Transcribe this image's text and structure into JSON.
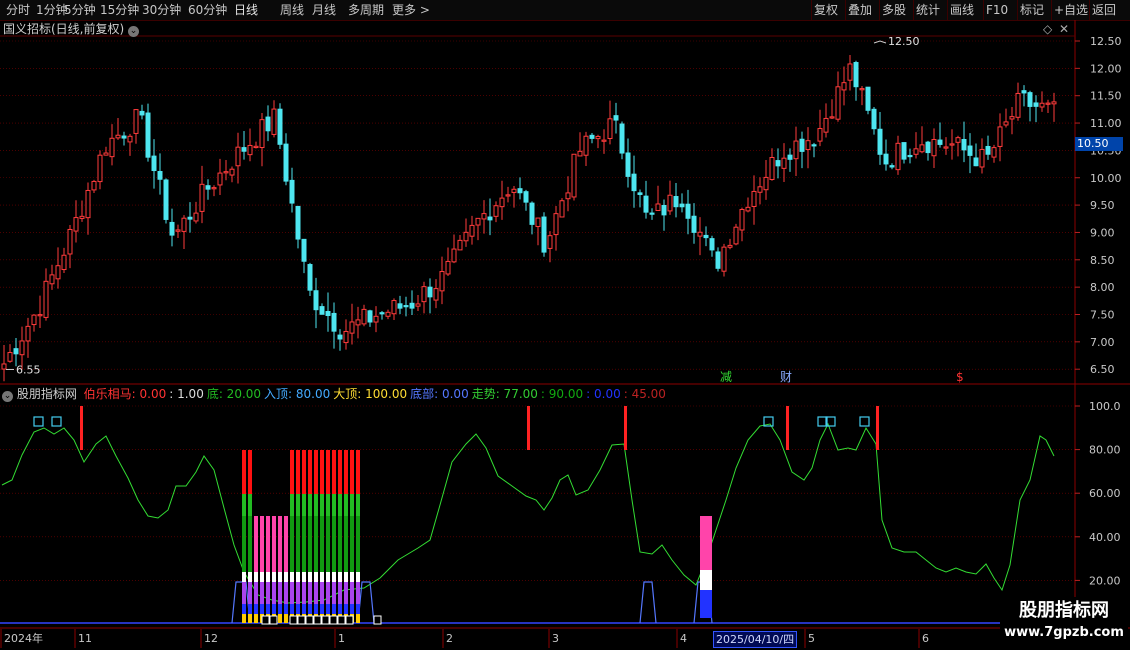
{
  "toolbar": {
    "left": [
      "分时",
      "1分钟",
      "5分钟",
      "15分钟",
      "30分钟",
      "60分钟",
      "日线",
      "周线",
      "月线",
      "多周期",
      "更多 >"
    ],
    "active": "日线",
    "right": [
      "复权",
      "叠加",
      "多股",
      "统计",
      "画线",
      "F10",
      "标记",
      "+自选",
      "返回"
    ]
  },
  "stock": {
    "title": "国义招标(日线,前复权)"
  },
  "price_axis": {
    "labels": [
      "12.50",
      "12.00",
      "11.50",
      "11.00",
      "10.50",
      "10.00",
      "9.50",
      "9.00",
      "8.50",
      "8.00",
      "7.50",
      "7.00",
      "6.50"
    ],
    "current": "10.50",
    "max_label": "12.50",
    "min_label": "6.55"
  },
  "markers": {
    "reduce": "减",
    "finance": "财",
    "dollar": "$"
  },
  "indicator": {
    "name": "股朋指标网",
    "params": [
      {
        "label": "伯乐相马:",
        "value": "0.00",
        "color": "#ff3333"
      },
      {
        "label": "",
        "value": ": 1.00",
        "color": "#dddddd"
      },
      {
        "label": "底:",
        "value": "20.00",
        "color": "#22bb22"
      },
      {
        "label": "入顶:",
        "value": "80.00",
        "color": "#44aaff"
      },
      {
        "label": "大顶:",
        "value": "100.00",
        "color": "#ffdd33"
      },
      {
        "label": "底部:",
        "value": "0.00",
        "color": "#5577ff"
      },
      {
        "label": "走势:",
        "value": "77.00",
        "color": "#33cc33"
      },
      {
        "label": "",
        "value": ": 90.00",
        "color": "#11aa11"
      },
      {
        "label": "",
        "value": ": 0.00",
        "color": "#2233ff"
      },
      {
        "label": "",
        "value": ": 45.00",
        "color": "#bb2222"
      }
    ],
    "axis_labels": [
      "100.0",
      "80.00",
      "60.00",
      "40.00",
      "20.00"
    ]
  },
  "date_axis": {
    "labels": [
      {
        "text": "2024年",
        "x": 4
      },
      {
        "text": "11",
        "x": 78
      },
      {
        "text": "12",
        "x": 204
      },
      {
        "text": "1",
        "x": 338
      },
      {
        "text": "2",
        "x": 446
      },
      {
        "text": "3",
        "x": 552
      },
      {
        "text": "4",
        "x": 680
      },
      {
        "text": "5",
        "x": 808
      },
      {
        "text": "6",
        "x": 922
      }
    ],
    "cursor_date": "2025/04/10/四"
  },
  "watermark": {
    "title": "股朋指标网",
    "url": "www.7gpzb.com"
  },
  "chart_data": [
    {
      "type": "candlestick",
      "title": "国义招标(日线,前复权)",
      "y_ticks": [
        6.5,
        7.0,
        7.5,
        8.0,
        8.5,
        9.0,
        9.5,
        10.0,
        10.5,
        11.0,
        11.5,
        12.0,
        12.5
      ],
      "annotations": {
        "high": 12.5,
        "low": 6.55,
        "last": 10.5
      },
      "key_closes": [
        6.6,
        7.6,
        9.0,
        10.6,
        11.1,
        8.9,
        9.8,
        10.5,
        11.1,
        7.9,
        7.2,
        7.5,
        7.7,
        8.2,
        9.2,
        9.9,
        8.8,
        10.5,
        11.0,
        9.2,
        9.7,
        8.4,
        9.7,
        10.5,
        10.8,
        12.0,
        10.3,
        10.7,
        10.6,
        10.3,
        11.4,
        11.2
      ]
    },
    {
      "type": "line",
      "name": "走势",
      "y_ticks": [
        20,
        40,
        60,
        80,
        100
      ],
      "levels": {
        "底": 20,
        "入顶": 80,
        "大顶": 100
      }
    }
  ]
}
